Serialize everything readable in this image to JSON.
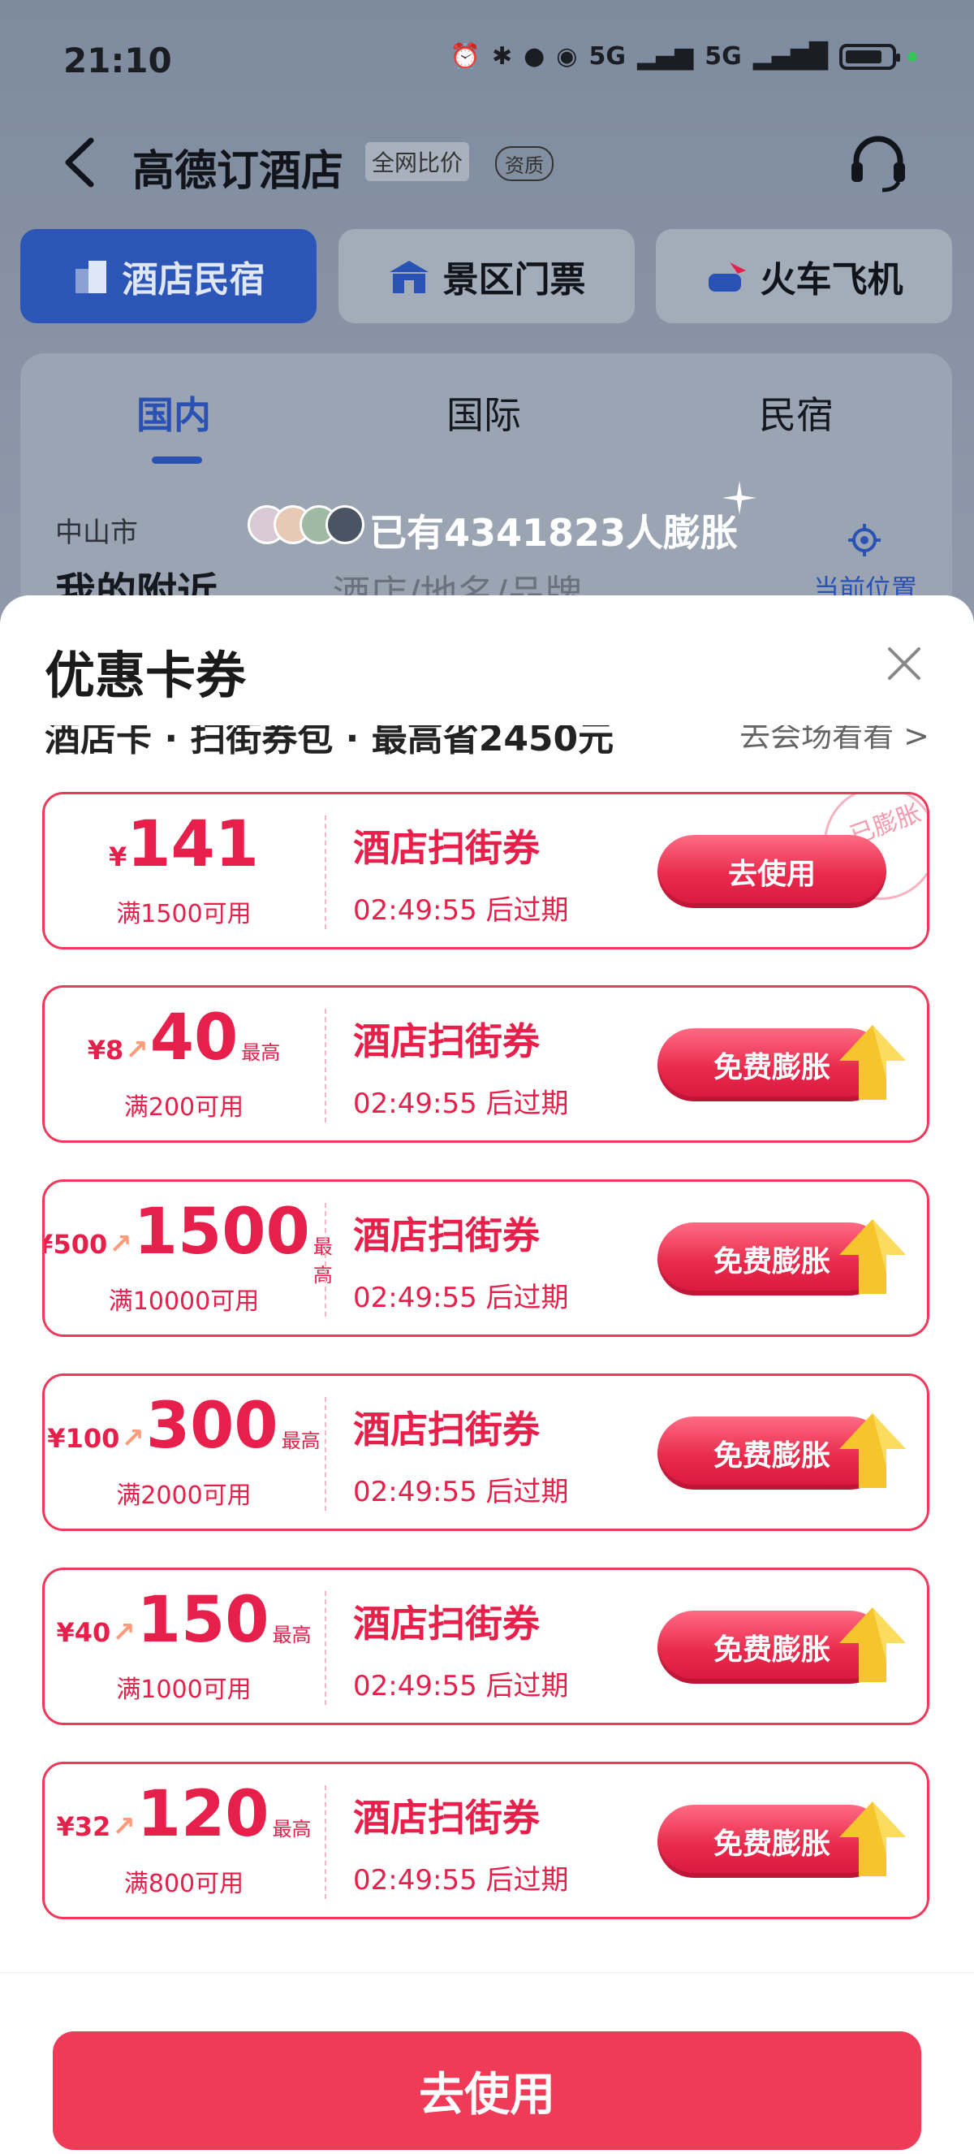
{
  "status_bar": {
    "time": "21:10",
    "network": "5G",
    "network2": "5G",
    "sim_index": "2"
  },
  "nav": {
    "title": "高德订酒店",
    "tag": "全网比价",
    "cert": "资质"
  },
  "categories": [
    {
      "label": "酒店民宿",
      "icon": "building-icon",
      "active": true
    },
    {
      "label": "景区门票",
      "icon": "ticket-booth-icon",
      "active": false
    },
    {
      "label": "火车飞机",
      "icon": "train-plane-icon",
      "active": false
    }
  ],
  "subtabs": [
    {
      "label": "国内",
      "active": true
    },
    {
      "label": "国际",
      "active": false
    },
    {
      "label": "民宿",
      "active": false
    }
  ],
  "search": {
    "city": "中山市",
    "location": "我的附近",
    "keyword_placeholder": "酒店/地名/品牌",
    "current_location": "当前位置"
  },
  "inflate_banner": "已有4341823人膨胀",
  "sheet": {
    "title": "优惠卡券",
    "cut_row_left": "酒店卡 · 扫街券包 · 最高省2450元",
    "cut_row_right": "去会场看看 >",
    "coupons": [
      {
        "yen": "¥",
        "from": "",
        "amount": "141",
        "max": "",
        "condition": "满1500可用",
        "name": "酒店扫街券",
        "expiry": "02:49:55 后过期",
        "button": "去使用",
        "stamp": "已膨胀"
      },
      {
        "yen": "¥",
        "from": "8",
        "amount": "40",
        "max": "最高",
        "condition": "满200可用",
        "name": "酒店扫街券",
        "expiry": "02:49:55 后过期",
        "button": "免费膨胀",
        "stamp": ""
      },
      {
        "yen": "¥",
        "from": "500",
        "amount": "1500",
        "max": "最高",
        "condition": "满10000可用",
        "name": "酒店扫街券",
        "expiry": "02:49:55 后过期",
        "button": "免费膨胀",
        "stamp": ""
      },
      {
        "yen": "¥",
        "from": "100",
        "amount": "300",
        "max": "最高",
        "condition": "满2000可用",
        "name": "酒店扫街券",
        "expiry": "02:49:55 后过期",
        "button": "免费膨胀",
        "stamp": ""
      },
      {
        "yen": "¥",
        "from": "40",
        "amount": "150",
        "max": "最高",
        "condition": "满1000可用",
        "name": "酒店扫街券",
        "expiry": "02:49:55 后过期",
        "button": "免费膨胀",
        "stamp": ""
      },
      {
        "yen": "¥",
        "from": "32",
        "amount": "120",
        "max": "最高",
        "condition": "满800可用",
        "name": "酒店扫街券",
        "expiry": "02:49:55 后过期",
        "button": "免费膨胀",
        "stamp": ""
      }
    ],
    "bottom_button": "去使用"
  },
  "colors": {
    "accent_red": "#e6204b",
    "button_red": "#ef3a58",
    "brand_blue": "#2a52b5"
  }
}
